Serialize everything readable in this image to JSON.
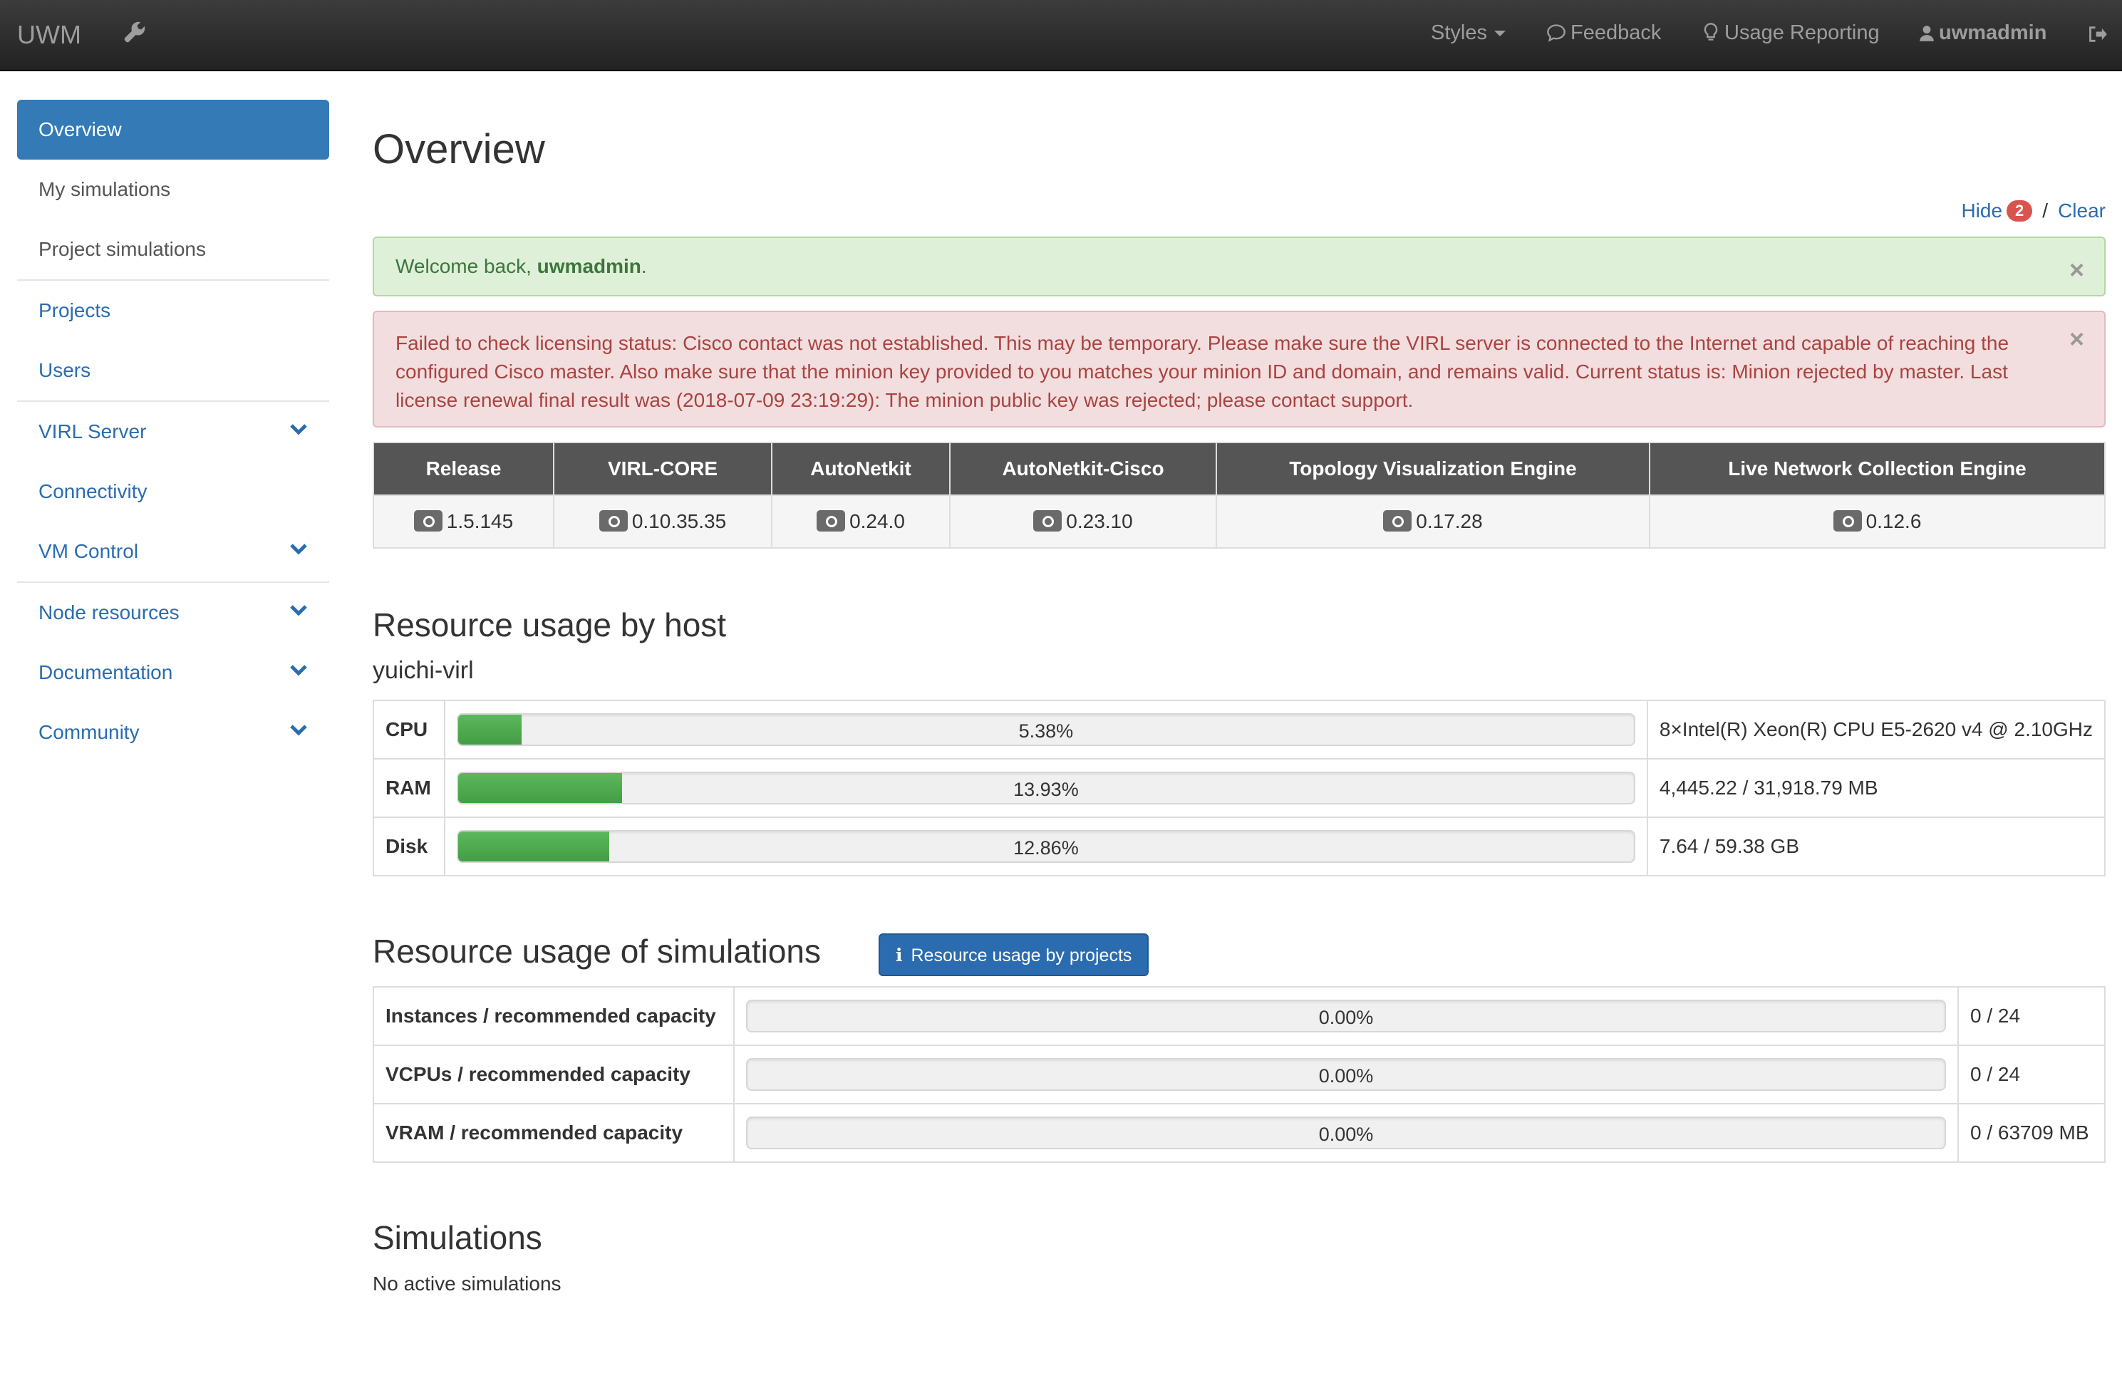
{
  "navbar": {
    "brand": "UWM",
    "styles": "Styles",
    "feedback": "Feedback",
    "usage_reporting": "Usage Reporting",
    "user": "uwmadmin"
  },
  "sidebar": {
    "items": [
      {
        "label": "Overview"
      },
      {
        "label": "My simulations"
      },
      {
        "label": "Project simulations"
      },
      {
        "label": "Projects"
      },
      {
        "label": "Users"
      },
      {
        "label": "VIRL Server"
      },
      {
        "label": "Connectivity"
      },
      {
        "label": "VM Control"
      },
      {
        "label": "Node resources"
      },
      {
        "label": "Documentation"
      },
      {
        "label": "Community"
      }
    ]
  },
  "main": {
    "title": "Overview",
    "hide_label": "Hide",
    "hide_count": "2",
    "slash": "/",
    "clear_label": "Clear",
    "welcome_prefix": "Welcome back, ",
    "welcome_user": "uwmadmin",
    "welcome_suffix": ".",
    "error_message": "Failed to check licensing status: Cisco contact was not established. This may be temporary. Please make sure the VIRL server is connected to the Internet and capable of reaching the configured Cisco master. Also make sure that the minion key provided to you matches your minion ID and domain, and remains valid. Current status is: Minion rejected by master. Last license renewal final result was (2018-07-09 23:19:29): The minion public key was rejected; please contact support.",
    "close_symbol": "×"
  },
  "versions": {
    "headers": [
      "Release",
      "VIRL-CORE",
      "AutoNetkit",
      "AutoNetkit-Cisco",
      "Topology Visualization Engine",
      "Live Network Collection Engine"
    ],
    "values": [
      "1.5.145",
      "0.10.35.35",
      "0.24.0",
      "0.23.10",
      "0.17.28",
      "0.12.6"
    ]
  },
  "host_usage": {
    "heading": "Resource usage by host",
    "host": "yuichi-virl",
    "rows": [
      {
        "label": "CPU",
        "percent": 5.38,
        "percent_text": "5.38%",
        "detail": "8×Intel(R) Xeon(R) CPU E5-2620 v4 @ 2.10GHz"
      },
      {
        "label": "RAM",
        "percent": 13.93,
        "percent_text": "13.93%",
        "detail": "4,445.22 / 31,918.79 MB"
      },
      {
        "label": "Disk",
        "percent": 12.86,
        "percent_text": "12.86%",
        "detail": "7.64 / 59.38 GB"
      }
    ]
  },
  "sim_usage": {
    "heading": "Resource usage of simulations",
    "button_label": "Resource usage by projects",
    "button_icon": "i",
    "rows": [
      {
        "label": "Instances / recommended capacity",
        "percent": 0,
        "percent_text": "0.00%",
        "detail": "0 / 24"
      },
      {
        "label": "VCPUs / recommended capacity",
        "percent": 0,
        "percent_text": "0.00%",
        "detail": "0 / 24"
      },
      {
        "label": "VRAM / recommended capacity",
        "percent": 0,
        "percent_text": "0.00%",
        "detail": "0 / 63709 MB"
      }
    ]
  },
  "simulations": {
    "heading": "Simulations",
    "empty_text": "No active simulations"
  },
  "colors": {
    "navbar": "#222222",
    "accent": "#337ab7",
    "success_bg": "#dff0d8",
    "danger_bg": "#f2dede",
    "progress": "#5cb85c",
    "badge": "#d9534f"
  }
}
